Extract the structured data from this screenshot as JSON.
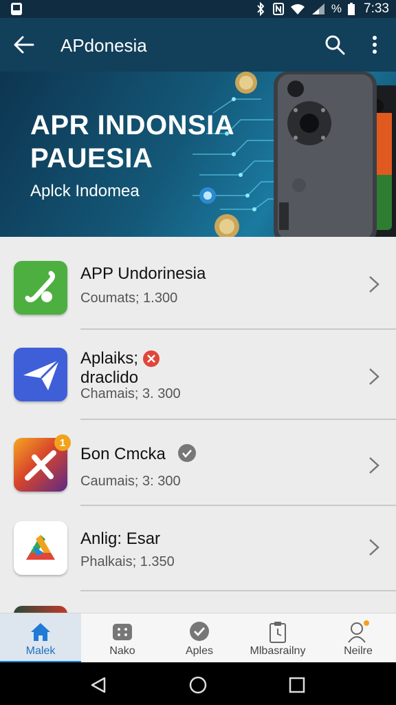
{
  "status_bar": {
    "icons": [
      "bluetooth-icon",
      "nfc-icon",
      "wifi-icon",
      "signal-icon",
      "battery-icon"
    ],
    "battery_text": "%",
    "time": "7:33"
  },
  "app_bar": {
    "title": "APdonesia"
  },
  "banner": {
    "title_line1": "APR INDONSIA",
    "title_line2": "PAUESIA",
    "subtitle": "Aplck Indomea"
  },
  "apps": [
    {
      "name": "APP Undorinesia",
      "meta": "Coumats;  1.300",
      "icon": "phone-icon",
      "color": "#4caf3f"
    },
    {
      "name": "Aplaiks;",
      "name2": "draclido",
      "meta": "Chamais; 3. 300",
      "icon": "send-icon",
      "color": "#3f5fd8",
      "badge": "x"
    },
    {
      "name": "Бon Cmcka",
      "meta": "Caumais; 3: 300",
      "icon": "star-icon",
      "color": "#d8452b",
      "badge": "1"
    },
    {
      "name": "Anlig: Esar",
      "meta": "Phalkais; 1.350",
      "icon": "drive-icon",
      "color": "#ffffff"
    }
  ],
  "bottom_nav": [
    {
      "label": "Malek",
      "icon": "home-icon",
      "active": true
    },
    {
      "label": "Nako",
      "icon": "grid-icon",
      "active": false
    },
    {
      "label": "Aples",
      "icon": "check-circle-icon",
      "active": false
    },
    {
      "label": "Mlbasrailny",
      "icon": "clipboard-icon",
      "active": false
    },
    {
      "label": "Neilre",
      "icon": "person-icon",
      "active": false
    }
  ],
  "colors": {
    "app_bar": "#123f5a",
    "status_bar": "#0f2c40",
    "accent": "#1f7bd6",
    "badge_red": "#e0463a",
    "badge_orange": "#f2a21a"
  }
}
